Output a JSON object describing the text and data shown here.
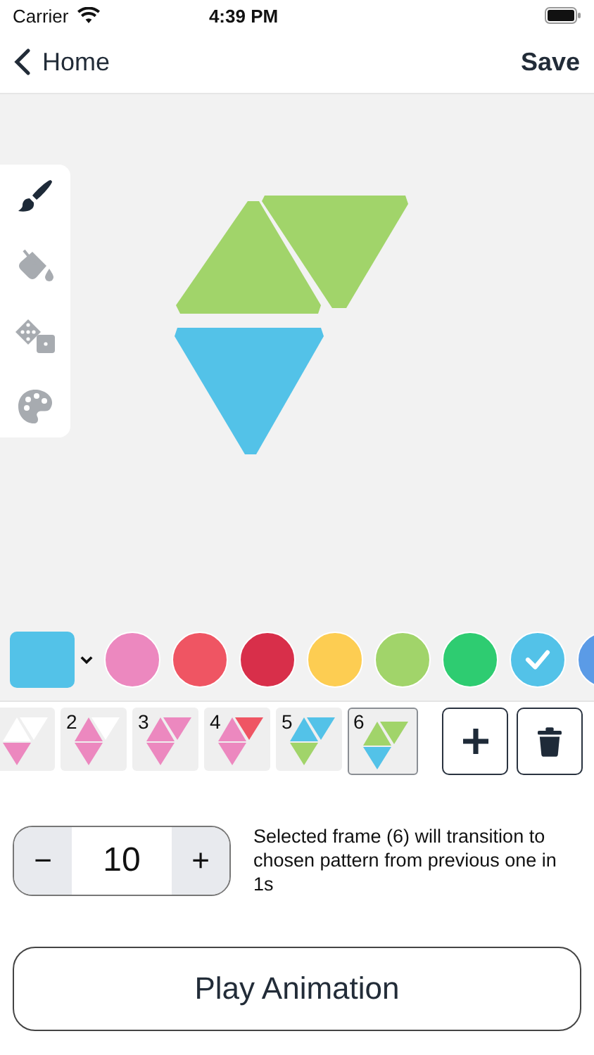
{
  "status_bar": {
    "carrier": "Carrier",
    "time": "4:39 PM"
  },
  "nav": {
    "back": "Home",
    "action": "Save"
  },
  "tools": [
    {
      "kind": "brush",
      "selected": true
    },
    {
      "kind": "bucket",
      "selected": false
    },
    {
      "kind": "dice",
      "selected": false
    },
    {
      "kind": "palette",
      "selected": false
    }
  ],
  "canvas": {
    "tiles": [
      {
        "kind": "up",
        "color": "#a1d46a"
      },
      {
        "kind": "down",
        "color": "#a1d46a"
      },
      {
        "kind": "bottom",
        "color": "#53c2e8"
      }
    ]
  },
  "current_color": {
    "color": "#53c2e8"
  },
  "swatches": [
    {
      "color": "#ec88bf",
      "selected": false
    },
    {
      "color": "#ef5563",
      "selected": false
    },
    {
      "color": "#d82f4a",
      "selected": false
    },
    {
      "color": "#fdcd52",
      "selected": false
    },
    {
      "color": "#a1d46a",
      "selected": false
    },
    {
      "color": "#2ecc71",
      "selected": false
    },
    {
      "color": "#53c2e8",
      "selected": true
    },
    {
      "color": "#5b9be6",
      "selected": false
    }
  ],
  "frames": [
    {
      "selected": false,
      "tiles": [
        {
          "color": "#ffffff"
        },
        {
          "color": "#ffffff"
        },
        {
          "color": "#ec88bf"
        }
      ]
    },
    {
      "label": "2",
      "selected": false,
      "tiles": [
        {
          "color": "#ec88bf"
        },
        {
          "color": "#ffffff"
        },
        {
          "color": "#ec88bf"
        }
      ]
    },
    {
      "label": "3",
      "selected": false,
      "tiles": [
        {
          "color": "#ec88bf"
        },
        {
          "color": "#ec88bf"
        },
        {
          "color": "#ec88bf"
        }
      ]
    },
    {
      "label": "4",
      "selected": false,
      "tiles": [
        {
          "color": "#ec88bf"
        },
        {
          "color": "#ef5563"
        },
        {
          "color": "#ec88bf"
        }
      ]
    },
    {
      "label": "5",
      "selected": false,
      "tiles": [
        {
          "color": "#53c2e8"
        },
        {
          "color": "#53c2e8"
        },
        {
          "color": "#a1d46a"
        }
      ]
    },
    {
      "label": "6",
      "selected": true,
      "tiles": [
        {
          "color": "#a1d46a"
        },
        {
          "color": "#a1d46a"
        },
        {
          "color": "#53c2e8"
        }
      ]
    }
  ],
  "stepper": {
    "minus": "−",
    "value": "10",
    "plus": "+"
  },
  "description": "Selected frame (6) will transition to chosen pattern from previous one in 1s",
  "play_button": "Play Animation"
}
